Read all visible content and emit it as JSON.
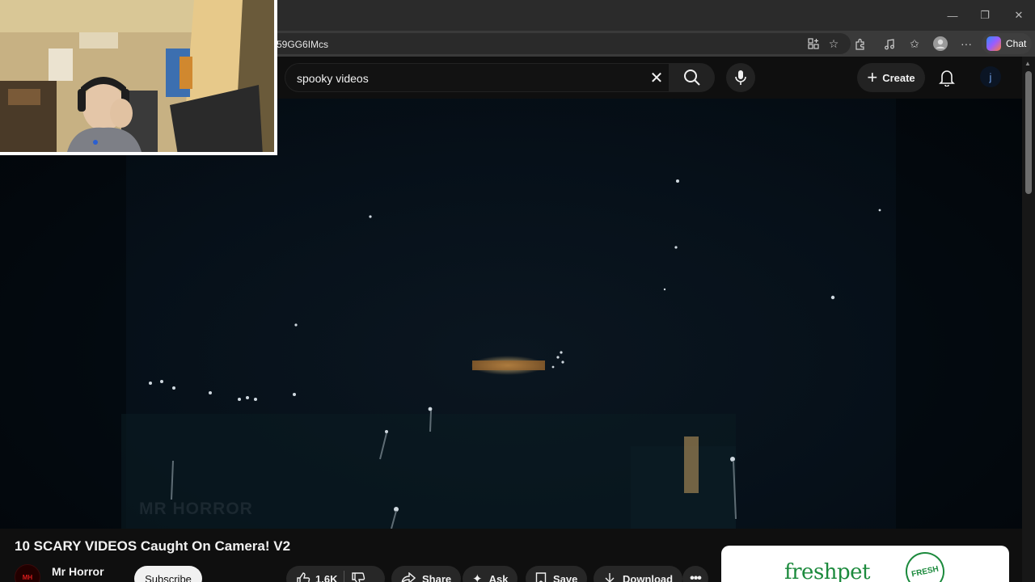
{
  "browser": {
    "url_fragment": "59GG6IMcs",
    "chat_label": "Chat",
    "icons": [
      "app-available-icon",
      "favorite-star-icon",
      "extensions-icon",
      "read-aloud-icon",
      "favorites-icon",
      "profile-icon",
      "more-icon",
      "copilot-icon"
    ]
  },
  "window_controls": [
    "minimize",
    "restore",
    "close"
  ],
  "youtube": {
    "search_value": "spooky videos",
    "create_label": "Create",
    "account_initial": "j"
  },
  "video": {
    "watermark": "MR HORROR",
    "title": "10 SCARY VIDEOS Caught On Camera! V2"
  },
  "channel": {
    "name": "Mr Horror",
    "avatar_text": "MH",
    "subscribe_label": "Subscribe"
  },
  "actions": {
    "like_count": "1.6K",
    "share_label": "Share",
    "ask_label": "Ask",
    "save_label": "Save",
    "download_label": "Download"
  },
  "ad": {
    "brand": "freshpet",
    "badge_text": "FRESH"
  },
  "colors": {
    "background": "#0f0f0f",
    "accent_ad": "#1c8a3d",
    "channel_red": "#d81b1b"
  }
}
